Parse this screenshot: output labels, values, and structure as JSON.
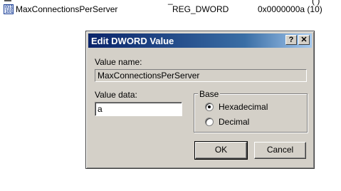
{
  "registry_row": {
    "icon": "reg-binary-icon",
    "icon_glyph": "0110 1011",
    "name": "MaxConnectionsPerServer",
    "type": "REG_DWORD",
    "data": "0x0000000a (10)",
    "cut_off_text": "(   )",
    "cut_off_underscore": "_"
  },
  "dialog": {
    "title": "Edit DWORD Value",
    "help_button": "?",
    "close_button": "✕",
    "value_name_label": "Value name:",
    "value_name": "MaxConnectionsPerServer",
    "value_data_label": "Value data:",
    "value_data": "a",
    "base_label": "Base",
    "base_options": [
      {
        "label": "Hexadecimal",
        "selected": true
      },
      {
        "label": "Decimal",
        "selected": false
      }
    ],
    "ok_label": "OK",
    "cancel_label": "Cancel"
  },
  "colors": {
    "titlebar_start": "#0a246a",
    "titlebar_end": "#a6caf0",
    "dialog_face": "#d4d0c8"
  }
}
